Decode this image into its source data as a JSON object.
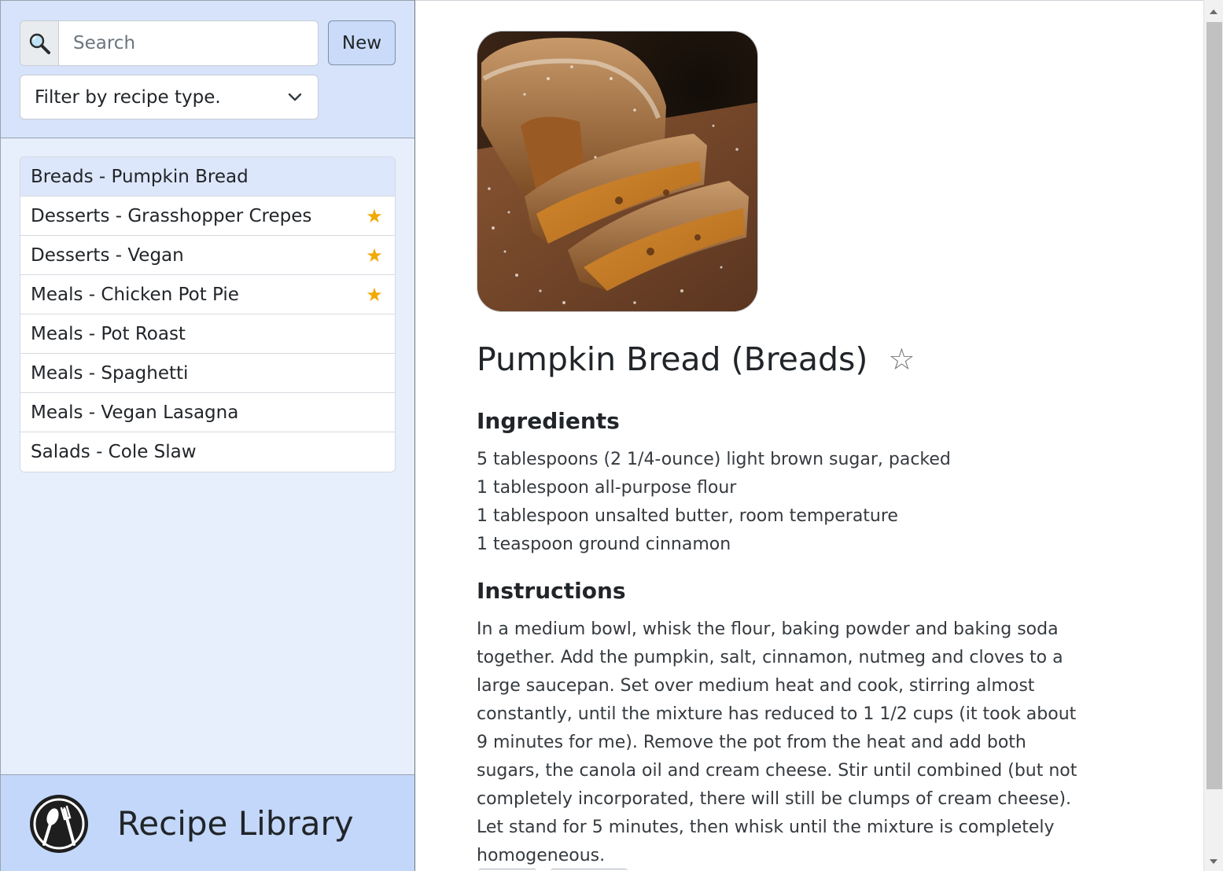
{
  "sidebar": {
    "search": {
      "placeholder": "Search",
      "value": ""
    },
    "new_label": "New",
    "filter_label": "Filter by recipe type.",
    "recipes": [
      {
        "label": "Breads - Pumpkin Bread",
        "favorite": false,
        "active": true
      },
      {
        "label": "Desserts - Grasshopper Crepes",
        "favorite": true,
        "active": false
      },
      {
        "label": "Desserts - Vegan",
        "favorite": true,
        "active": false
      },
      {
        "label": "Meals - Chicken Pot Pie",
        "favorite": true,
        "active": false
      },
      {
        "label": "Meals - Pot Roast",
        "favorite": false,
        "active": false
      },
      {
        "label": "Meals - Spaghetti",
        "favorite": false,
        "active": false
      },
      {
        "label": "Meals - Vegan Lasagna",
        "favorite": false,
        "active": false
      },
      {
        "label": "Salads - Cole Slaw",
        "favorite": false,
        "active": false
      }
    ],
    "star_glyph": "★",
    "brand": {
      "title": "Recipe Library",
      "icon": "spoon-fork-logo-icon"
    }
  },
  "recipe": {
    "photo_icon": "pumpkin-bread-photo",
    "title": "Pumpkin Bread (Breads)",
    "favorite_glyph": "☆",
    "favorite": false,
    "ingredients_heading": "Ingredients",
    "ingredients": [
      "5 tablespoons (2 1/4-ounce) light brown sugar, packed",
      "1 tablespoon all-purpose flour",
      "1 tablespoon unsalted butter, room temperature",
      "1 teaspoon ground cinnamon"
    ],
    "instructions_heading": "Instructions",
    "instructions": "In a medium bowl, whisk the flour, baking powder and baking soda together. Add the pumpkin, salt, cinnamon, nutmeg and cloves to a large saucepan. Set over medium heat and cook, stirring almost constantly, until the mixture has reduced to 1 1/2 cups (it took about 9 minutes for me). Remove the pot from the heat and add both sugars, the canola oil and cream cheese. Stir until combined (but not completely incorporated, there will still be clumps of cream cheese). Let stand for 5 minutes, then whisk until the mixture is completely homogeneous."
  },
  "colors": {
    "sidebar_bg": "#e7eefc",
    "sidebar_top_bg": "#d6e3fb",
    "brand_bar_bg": "#c3d7fa",
    "active_item_bg": "#dde7fb",
    "star_color": "#f2a900"
  }
}
